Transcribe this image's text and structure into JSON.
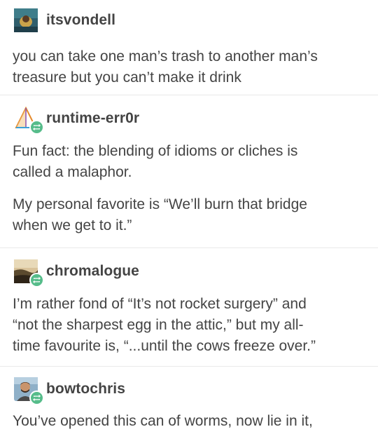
{
  "posts": [
    {
      "username": "itsvondell",
      "reblog": false,
      "paragraphs": [
        "you can take one man’s trash to another man’s",
        "treasure but you can’t make it drink"
      ]
    },
    {
      "username": "runtime-err0r",
      "reblog": true,
      "paragraphs": [
        "Fun fact: the blending of idioms or cliches is",
        "called a malaphor.",
        "My personal favorite is “We’ll burn that bridge",
        "when we get to it.”"
      ]
    },
    {
      "username": "chromalogue",
      "reblog": true,
      "paragraphs": [
        "I’m rather fond of “It’s not rocket surgery” and",
        "“not the sharpest egg in the attic,” but my all-",
        "time favourite is, “...until the cows freeze over.”"
      ]
    },
    {
      "username": "bowtochris",
      "reblog": true,
      "paragraphs": [
        "You’ve opened this can of worms, now lie in it,"
      ]
    }
  ],
  "colors": {
    "text": "#444444",
    "reblog_badge": "#56bc8a",
    "divider": "#e9e9e9"
  },
  "icons": {
    "avatar_1": "avatar-itsvondell",
    "avatar_2": "avatar-runtime-err0r",
    "avatar_3": "avatar-chromalogue",
    "avatar_4": "avatar-bowtochris",
    "reblog": "reblog-icon"
  }
}
